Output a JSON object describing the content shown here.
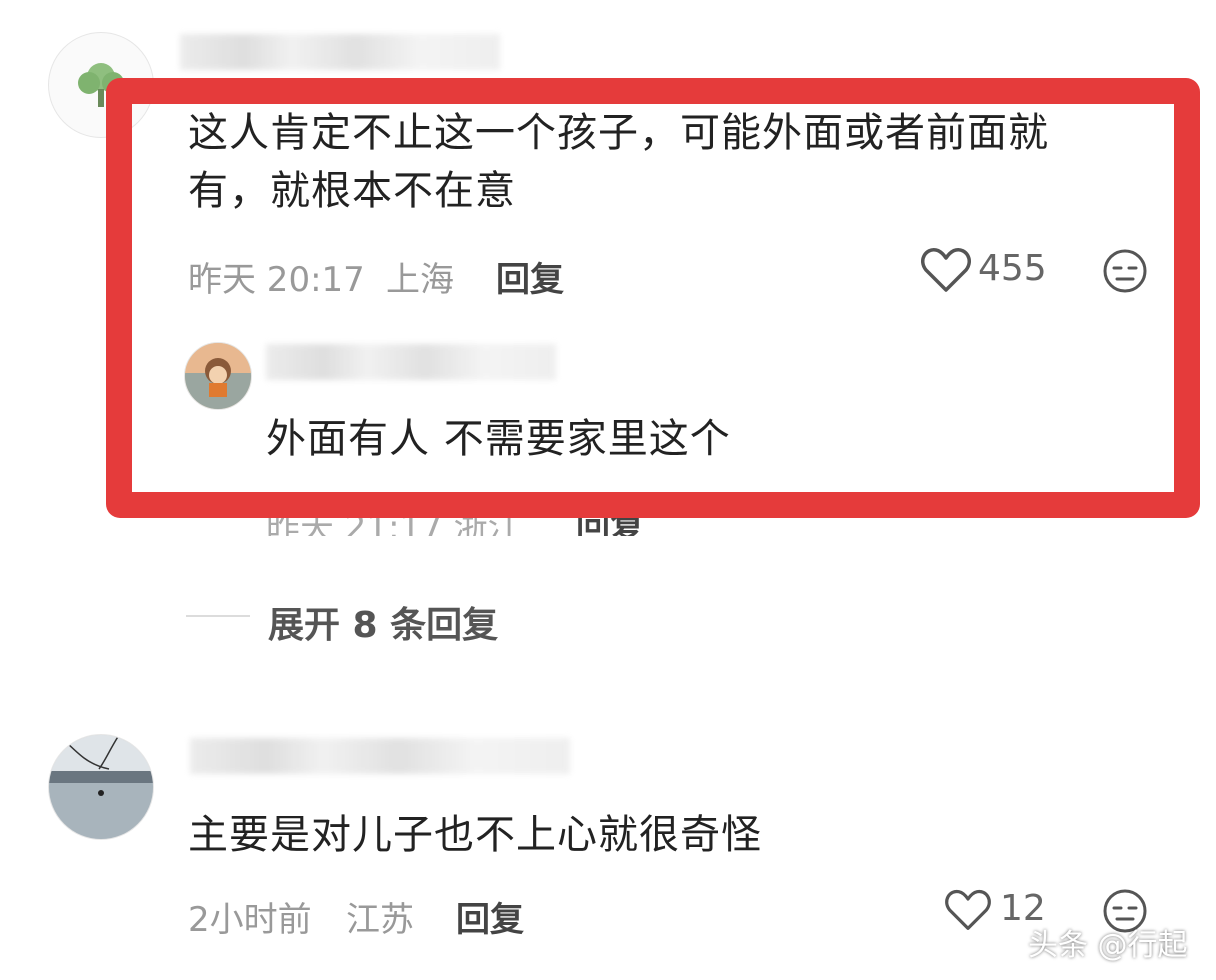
{
  "comment1": {
    "text": "这人肯定不止这一个孩子，可能外面或者前面就有，就根本不在意",
    "text_line1": "这人肯定不止这一个孩子，可能外面或者前面就",
    "text_line2": "有，就根本不在意",
    "time": "昨天 20:17",
    "location": "上海",
    "reply_label": "回复",
    "likes": "455"
  },
  "reply1": {
    "text": "外面有人 不需要家里这个",
    "meta_partial": "昨天 21:17 浙江",
    "reply_label": "回复"
  },
  "expand": {
    "label": "展开 8 条回复"
  },
  "comment2": {
    "text": "主要是对儿子也不上心就很奇怪",
    "time": "2小时前",
    "location": "江苏",
    "reply_label": "回复",
    "likes": "12"
  },
  "watermark": "头条 @行起",
  "colors": {
    "highlight": "#e53b3b",
    "meta": "#999999",
    "text": "#222222"
  }
}
